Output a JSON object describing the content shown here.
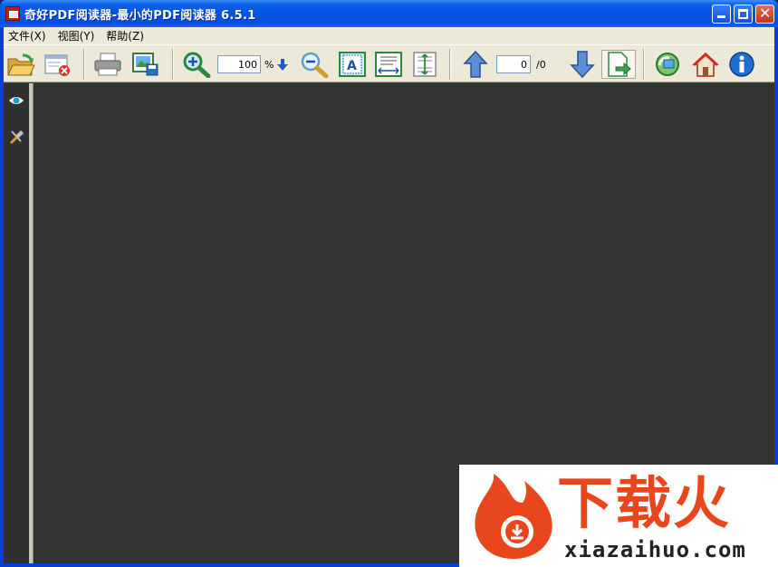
{
  "window": {
    "title": "奇好PDF阅读器-最小的PDF阅读器 6.5.1"
  },
  "menu": [
    {
      "label": "文件(X)"
    },
    {
      "label": "视图(Y)"
    },
    {
      "label": "帮助(Z)"
    }
  ],
  "toolbar": {
    "zoom_value": "100",
    "zoom_unit": "%",
    "page_value": "0",
    "page_total": "/0",
    "icons": {
      "open": "folder-open-icon",
      "close": "close-file-icon",
      "print": "printer-icon",
      "save_image": "save-image-icon",
      "zoom_in": "zoom-in-icon",
      "zoom_dropdown": "zoom-dropdown-arrow-icon",
      "zoom_out": "zoom-out-icon",
      "fit_page": "fit-page-icon",
      "fit_width": "fit-width-icon",
      "fit_height": "fit-height-icon",
      "prev_page": "arrow-up-icon",
      "next_page": "arrow-down-icon",
      "goto_page": "go-to-page-icon",
      "update": "update-icon",
      "home": "home-icon",
      "about": "info-icon"
    }
  },
  "sidebar": {
    "items": [
      {
        "icon": "eye-icon"
      },
      {
        "icon": "tools-icon"
      }
    ]
  },
  "watermark": {
    "brand": "下载火",
    "domain": "xiazaihuo.com"
  },
  "colors": {
    "titlebar": "#0454e0",
    "viewer_bg": "#333333",
    "sidebar_bg": "#303030",
    "chrome_bg": "#ece9d8",
    "watermark_accent": "#e8461c"
  }
}
